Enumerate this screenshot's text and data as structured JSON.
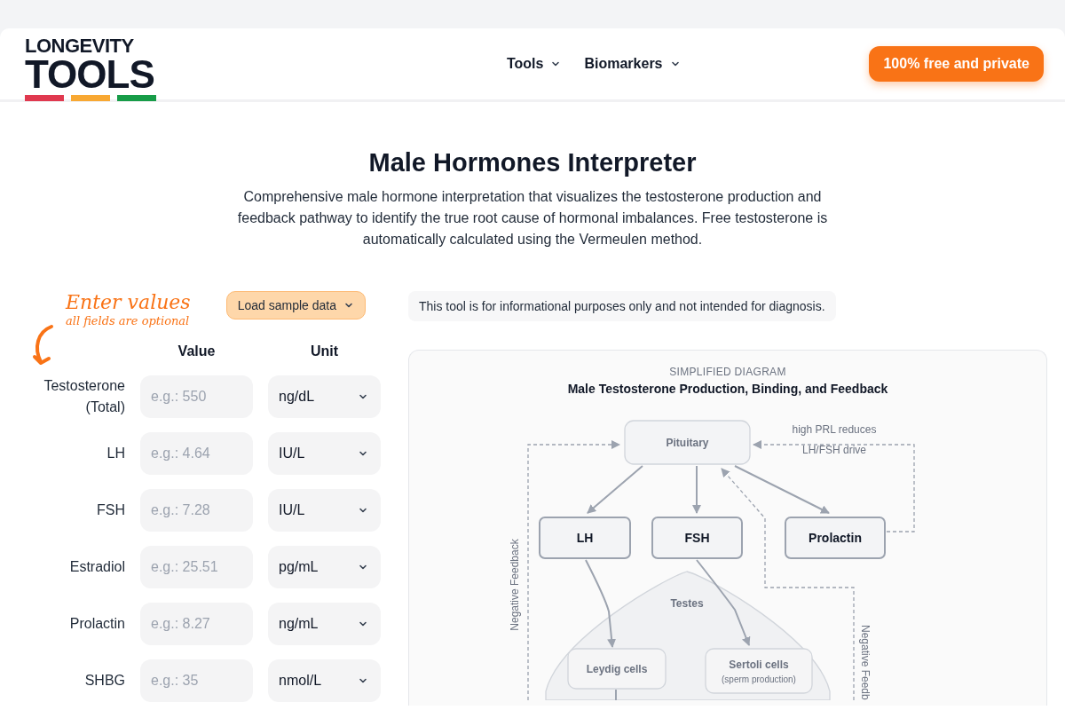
{
  "header": {
    "logo": {
      "line_1": "LONGEVITY",
      "line_2": "TOOLS"
    },
    "nav": [
      {
        "label": "Tools"
      },
      {
        "label": "Biomarkers"
      }
    ],
    "cta": "100% free and private"
  },
  "title": "Male Hormones Interpreter",
  "description": "Comprehensive male hormone interpretation that visualizes the testosterone production and feedback pathway to identify the true root cause of hormonal imbalances. Free testosterone is automatically calculated using the Vermeulen method.",
  "form": {
    "hint_title": "Enter values",
    "hint_subtitle": "all fields are optional",
    "sample_button": "Load sample data",
    "columns": [
      "Value",
      "Unit"
    ],
    "rows": [
      {
        "label": "Testosterone (Total)",
        "placeholder": "e.g.: 550",
        "unit": "ng/dL"
      },
      {
        "label": "LH",
        "placeholder": "e.g.: 4.64",
        "unit": "IU/L"
      },
      {
        "label": "FSH",
        "placeholder": "e.g.: 7.28",
        "unit": "IU/L"
      },
      {
        "label": "Estradiol",
        "placeholder": "e.g.: 25.51",
        "unit": "pg/mL"
      },
      {
        "label": "Prolactin",
        "placeholder": "e.g.: 8.27",
        "unit": "ng/mL"
      },
      {
        "label": "SHBG",
        "placeholder": "e.g.: 35",
        "unit": "nmol/L"
      }
    ]
  },
  "disclaimer": "This tool is for informational purposes only and not intended for diagnosis.",
  "diagram": {
    "eyebrow": "SIMPLIFIED DIAGRAM",
    "title": "Male Testosterone Production, Binding, and Feedback",
    "nodes": [
      {
        "kind": "hub",
        "label": "Pituitary"
      },
      {
        "kind": "hormone",
        "label": "LH"
      },
      {
        "kind": "hormone",
        "label": "FSH"
      },
      {
        "kind": "hormone",
        "label": "Prolactin"
      },
      {
        "kind": "cell",
        "label": "Leydig cells"
      },
      {
        "kind": "cell",
        "label": "Sertoli cells",
        "note": "(sperm production)"
      }
    ],
    "organ": "Testes",
    "notes": [
      "high PRL reduces",
      "LH/FSH drive"
    ],
    "feedback_left": "Negative Feedback",
    "feedback_right": "Negative Feedb"
  }
}
